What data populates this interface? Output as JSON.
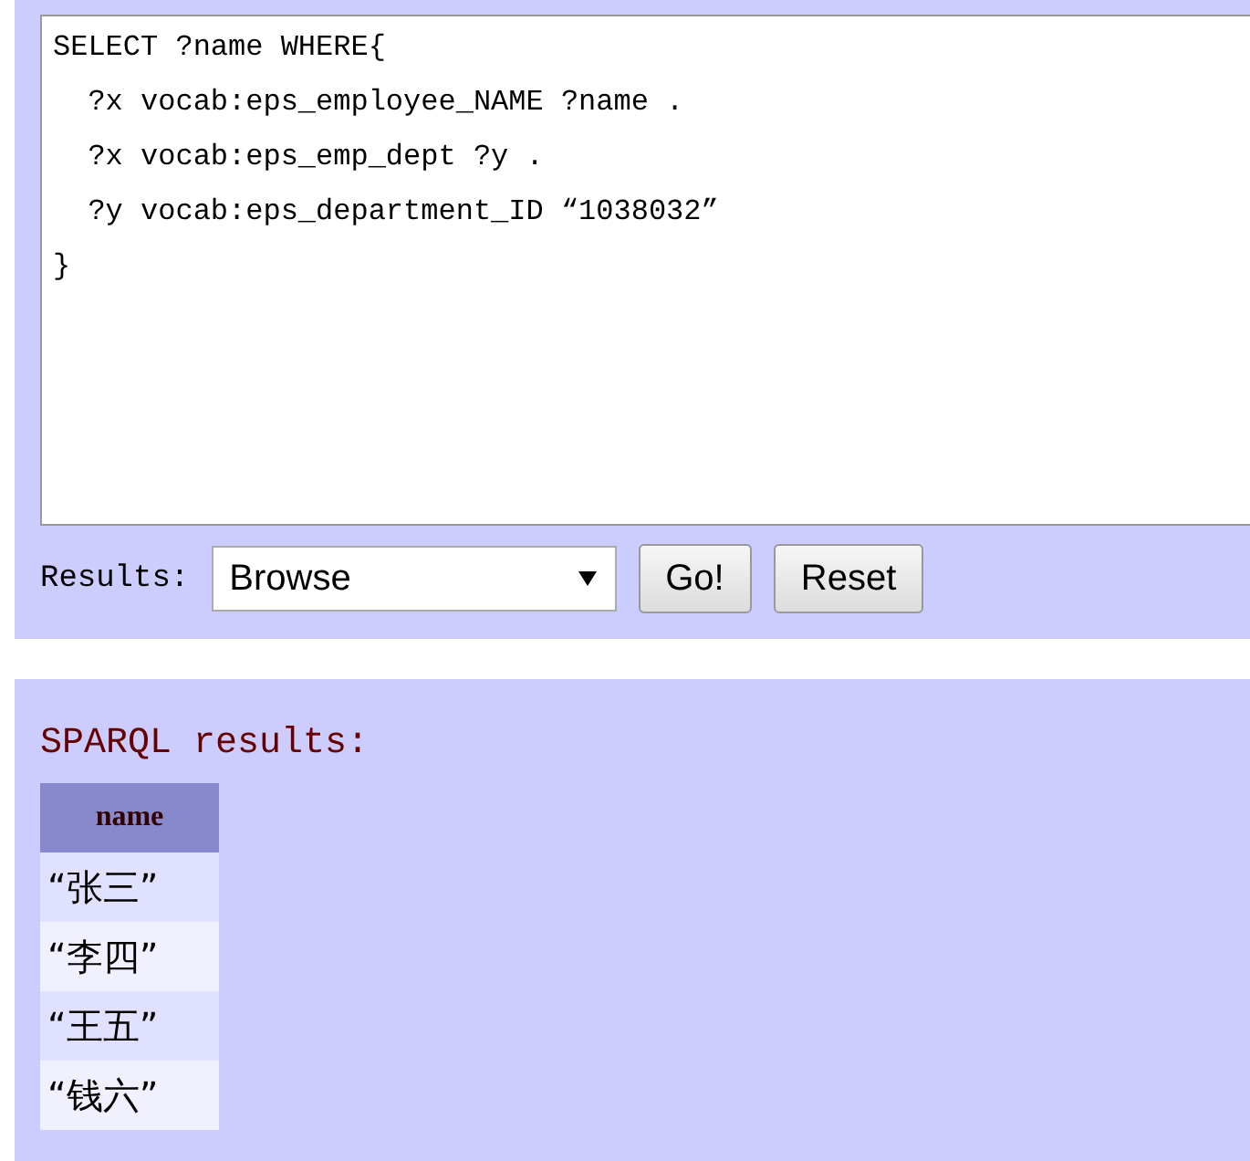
{
  "query": {
    "lines": [
      "SELECT ?name WHERE{",
      "  ?x vocab:eps_employee_NAME ?name .",
      "  ?x vocab:eps_emp_dept ?y .",
      "  ?y vocab:eps_department_ID “1038032”",
      "}"
    ]
  },
  "results_label": "Results:",
  "results_select": {
    "value": "Browse"
  },
  "buttons": [
    "Go!",
    "Reset"
  ],
  "results_title": "SPARQL results:",
  "table": {
    "columns": [
      "name"
    ],
    "rows": [
      [
        "“张三”"
      ],
      [
        "“李四”"
      ],
      [
        "“王五”"
      ],
      [
        "“钱六”"
      ]
    ]
  }
}
